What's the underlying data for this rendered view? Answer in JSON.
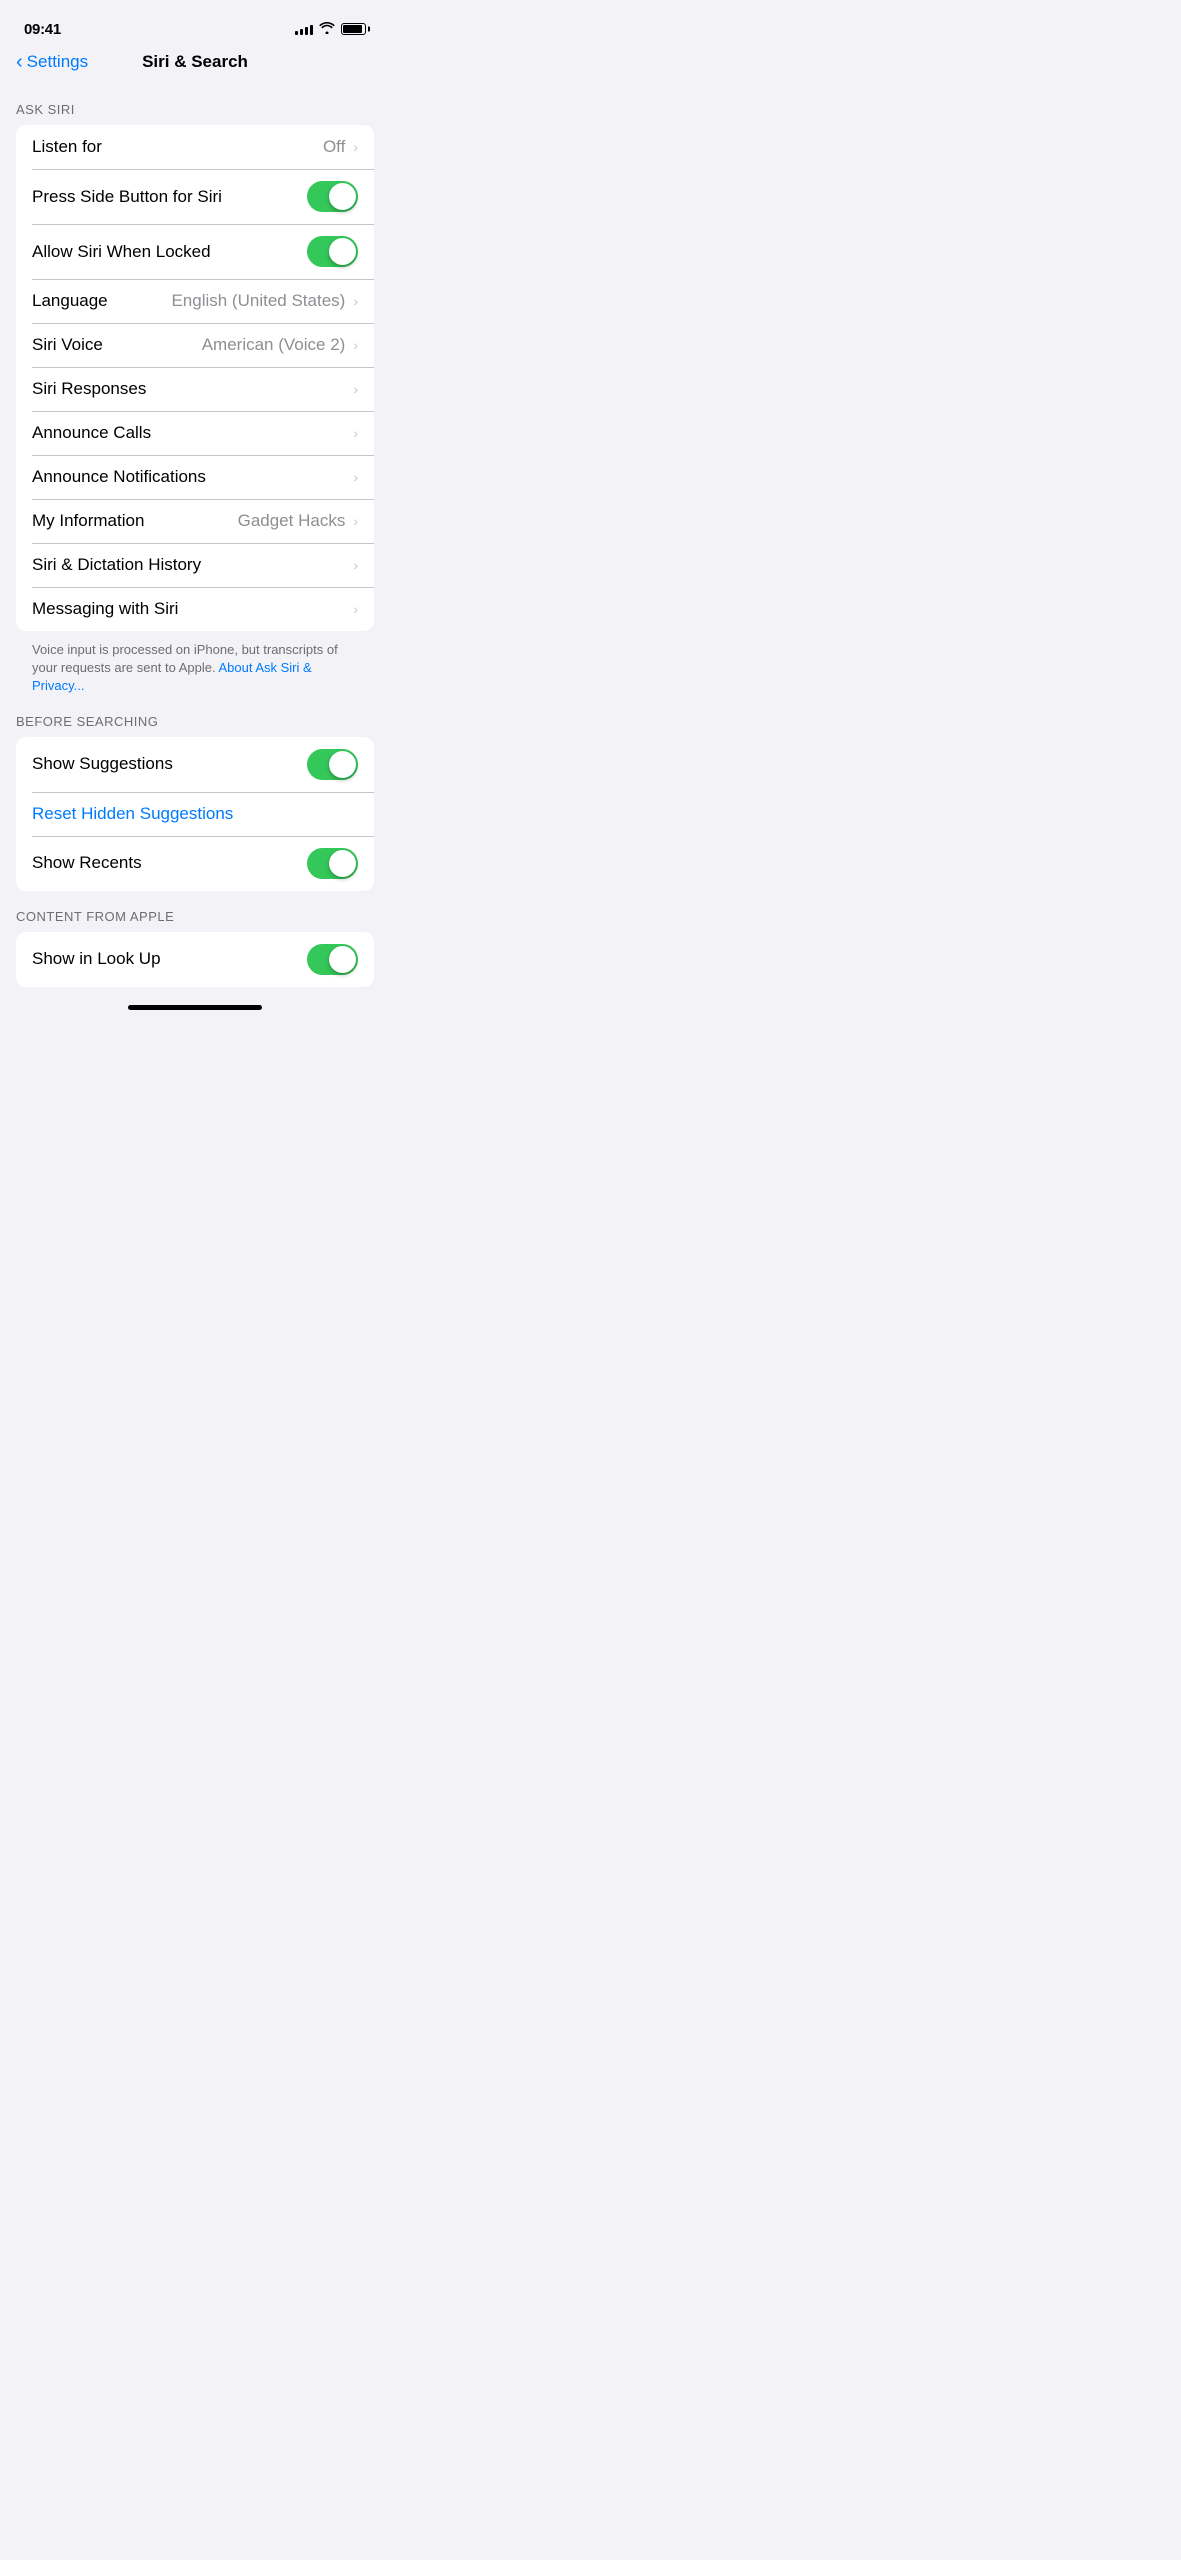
{
  "statusBar": {
    "time": "09:41",
    "signalBars": [
      4,
      6,
      8,
      10,
      12
    ],
    "batteryPercent": 90
  },
  "header": {
    "backLabel": "Settings",
    "title": "Siri & Search"
  },
  "askSiriSection": {
    "label": "ASK SIRI",
    "rows": [
      {
        "id": "listen-for",
        "label": "Listen for",
        "valueText": "Off",
        "type": "chevron"
      },
      {
        "id": "press-side-button",
        "label": "Press Side Button for Siri",
        "type": "toggle",
        "toggleOn": true
      },
      {
        "id": "allow-when-locked",
        "label": "Allow Siri When Locked",
        "type": "toggle",
        "toggleOn": true
      },
      {
        "id": "language",
        "label": "Language",
        "valueText": "English (United States)",
        "type": "chevron"
      },
      {
        "id": "siri-voice",
        "label": "Siri Voice",
        "valueText": "American (Voice 2)",
        "type": "chevron"
      },
      {
        "id": "siri-responses",
        "label": "Siri Responses",
        "type": "chevron-only"
      },
      {
        "id": "announce-calls",
        "label": "Announce Calls",
        "type": "chevron-only"
      },
      {
        "id": "announce-notifications",
        "label": "Announce Notifications",
        "type": "chevron-only"
      },
      {
        "id": "my-information",
        "label": "My Information",
        "valueText": "Gadget Hacks",
        "type": "chevron"
      },
      {
        "id": "siri-dictation-history",
        "label": "Siri & Dictation History",
        "type": "chevron-only"
      },
      {
        "id": "messaging-with-siri",
        "label": "Messaging with Siri",
        "type": "chevron-only"
      }
    ],
    "footerText": "Voice input is processed on iPhone, but transcripts of your requests are sent to Apple.",
    "footerLinkText": "About Ask Siri & Privacy...",
    "footerLinkHref": "#"
  },
  "beforeSearchingSection": {
    "label": "BEFORE SEARCHING",
    "rows": [
      {
        "id": "show-suggestions",
        "label": "Show Suggestions",
        "type": "toggle",
        "toggleOn": true
      },
      {
        "id": "reset-hidden-suggestions",
        "label": "Reset Hidden Suggestions",
        "type": "link"
      },
      {
        "id": "show-recents",
        "label": "Show Recents",
        "type": "toggle",
        "toggleOn": true
      }
    ]
  },
  "contentFromAppleSection": {
    "label": "CONTENT FROM APPLE",
    "rows": [
      {
        "id": "show-in-look-up",
        "label": "Show in Look Up",
        "type": "toggle",
        "toggleOn": true
      }
    ]
  }
}
